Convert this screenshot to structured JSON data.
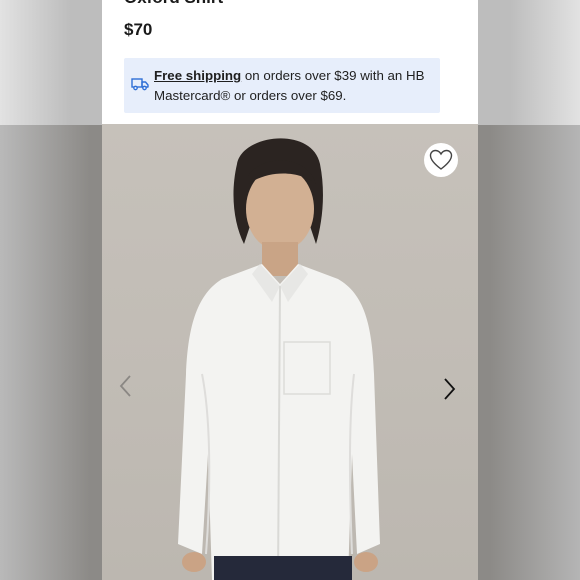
{
  "product": {
    "title_partial": "Oxford Shirt",
    "price": "$70"
  },
  "promo": {
    "icon": "truck-icon",
    "link_text": "Free shipping",
    "body_text": " on orders over $39 with an HB Mastercard® or orders over $69."
  },
  "gallery": {
    "favorite_icon": "heart-icon",
    "prev_icon": "chevron-left-icon",
    "next_icon": "chevron-right-icon"
  },
  "colors": {
    "promo_background": "#e7eefb",
    "image_background": "#c4bfb8",
    "text": "#1a1a1a"
  }
}
